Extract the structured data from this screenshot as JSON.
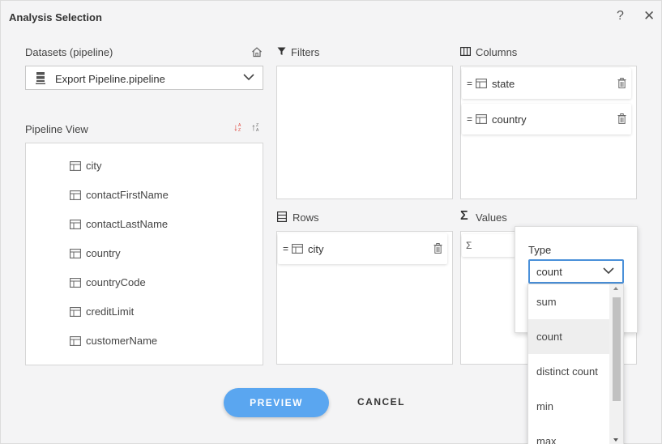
{
  "dialog": {
    "title": "Analysis Selection",
    "help": "?",
    "close": "✕"
  },
  "datasets": {
    "label": "Datasets (pipeline)",
    "selected": "Export Pipeline.pipeline"
  },
  "pipeline_view": {
    "label": "Pipeline View",
    "sort_desc_label": "↓",
    "sort_asc_label": "↑",
    "fields": [
      "city",
      "contactFirstName",
      "contactLastName",
      "country",
      "countryCode",
      "creditLimit",
      "customerName"
    ]
  },
  "filters": {
    "label": "Filters"
  },
  "columns": {
    "label": "Columns",
    "items": [
      "state",
      "country"
    ]
  },
  "rows": {
    "label": "Rows",
    "items": [
      "city"
    ]
  },
  "values": {
    "label": "Values",
    "sigma": "Σ"
  },
  "type_popup": {
    "label": "Type",
    "selected": "count",
    "options": [
      "sum",
      "count",
      "distinct count",
      "min",
      "max"
    ]
  },
  "actions": {
    "preview": "PREVIEW",
    "cancel": "CANCEL"
  },
  "colors": {
    "accent": "#5aa6f0",
    "sort_desc": "#e0443a",
    "focus": "#4a90d9"
  }
}
